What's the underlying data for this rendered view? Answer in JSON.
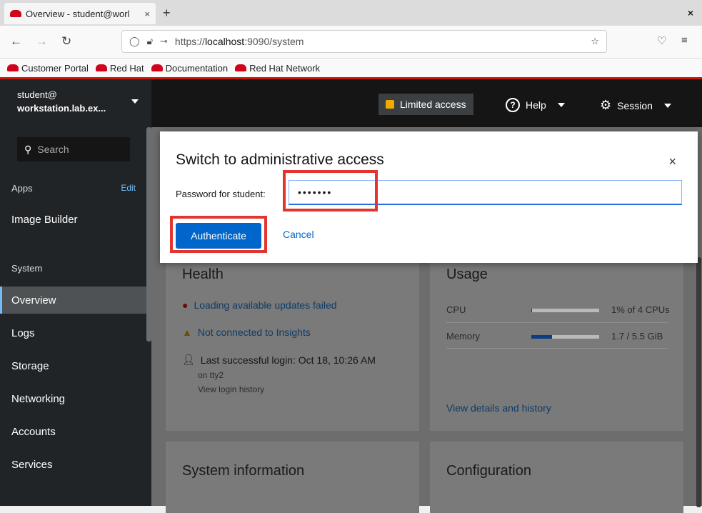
{
  "browser": {
    "tab_title": "Overview - student@worl",
    "tab_close": "×",
    "new_tab": "+",
    "window_close": "×",
    "url_prefix": "https://",
    "url_host": "localhost",
    "url_rest": ":9090/system",
    "bookmarks": [
      "Customer Portal",
      "Red Hat",
      "Documentation",
      "Red Hat Network"
    ]
  },
  "topbar": {
    "host_user": "student@",
    "host_name": "workstation.lab.ex...",
    "limited_access": "Limited access",
    "help": "Help",
    "session": "Session"
  },
  "sidebar": {
    "search_placeholder": "Search",
    "apps_header": "Apps",
    "edit": "Edit",
    "image_builder": "Image Builder",
    "system_header": "System",
    "items": [
      "Overview",
      "Logs",
      "Storage",
      "Networking",
      "Accounts",
      "Services"
    ]
  },
  "health": {
    "title": "Health",
    "updates_failed": "Loading available updates failed",
    "insights": "Not connected to Insights",
    "last_login": "Last successful login: Oct 18, 10:26 AM",
    "on_tty": "on tty2",
    "view_history": "View login history"
  },
  "usage": {
    "title": "Usage",
    "cpu_label": "CPU",
    "cpu_value": "1% of 4 CPUs",
    "cpu_fraction": 0.01,
    "memory_label": "Memory",
    "memory_value": "1.7 / 5.5 GiB",
    "memory_fraction": 0.31,
    "view_details": "View details and history"
  },
  "system_info": {
    "title": "System information"
  },
  "configuration": {
    "title": "Configuration"
  },
  "modal": {
    "title": "Switch to administrative access",
    "close": "×",
    "password_label": "Password for student:",
    "password_value": "•••••••",
    "authenticate": "Authenticate",
    "cancel": "Cancel"
  }
}
